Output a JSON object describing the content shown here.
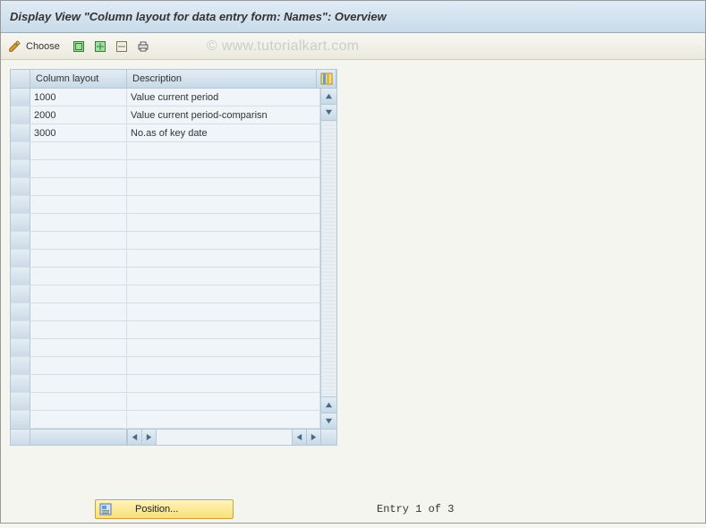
{
  "header": {
    "title": "Display View \"Column layout for data entry form: Names\": Overview"
  },
  "toolbar": {
    "choose_label": "Choose"
  },
  "watermark": "© www.tutorialkart.com",
  "table": {
    "columns": {
      "layout": "Column layout",
      "desc": "Description"
    },
    "rows": [
      {
        "layout": "1000",
        "desc": "Value current period"
      },
      {
        "layout": "2000",
        "desc": "Value current period-comparisn"
      },
      {
        "layout": "3000",
        "desc": "No.as of key date"
      }
    ]
  },
  "footer": {
    "position_label": "Position...",
    "entry_text": "Entry 1 of 3"
  }
}
